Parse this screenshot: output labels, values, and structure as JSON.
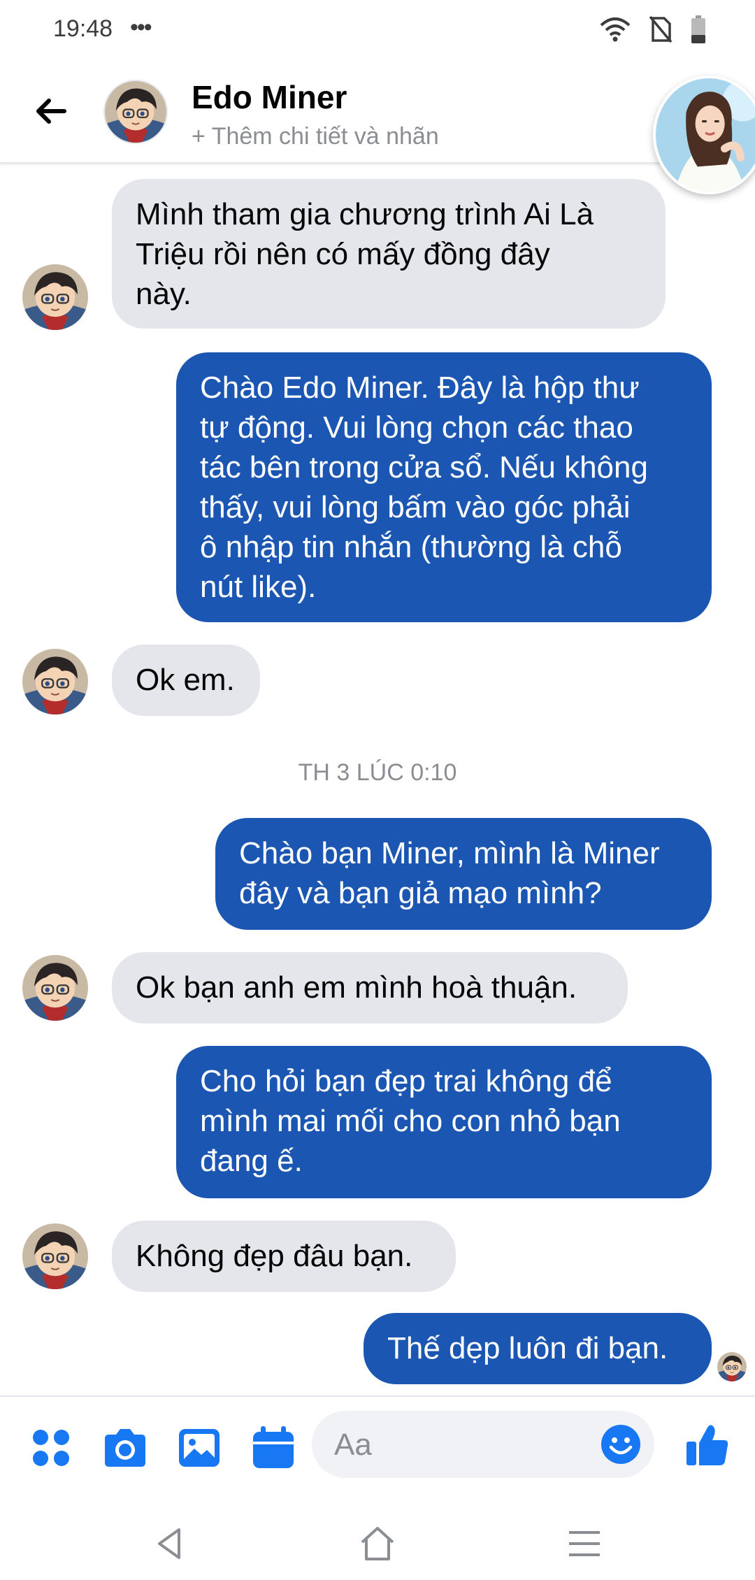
{
  "status": {
    "time": "19:48",
    "dots": "•••"
  },
  "header": {
    "contact_name": "Edo Miner",
    "subtitle": "+ Thêm chi tiết và nhãn"
  },
  "messages": [
    {
      "from": "them",
      "text_lines": [
        "Mình tham gia chương trình Ai Là",
        "Triệu rồi nên có mấy đồng đây",
        "này."
      ]
    },
    {
      "from": "me",
      "text_lines": [
        "Chào Edo Miner. Đây là hộp thư",
        "tự động. Vui lòng chọn các thao",
        "tác bên trong cửa sổ. Nếu không",
        "thấy, vui lòng bấm vào góc phải",
        "ô nhập tin nhắn (thường là chỗ",
        "nút like)."
      ]
    },
    {
      "from": "them",
      "text_lines": [
        "Ok em."
      ]
    },
    {
      "from": "me",
      "text_lines": [
        "Chào bạn Miner, mình là Miner",
        "đây và bạn giả mạo mình?"
      ]
    },
    {
      "from": "them",
      "text_lines": [
        "Ok bạn anh em mình hoà thuận."
      ]
    },
    {
      "from": "me",
      "text_lines": [
        "Cho hỏi bạn đẹp trai không để",
        "mình mai mối cho con nhỏ bạn",
        "đang ế."
      ]
    },
    {
      "from": "them",
      "text_lines": [
        "Không đẹp đâu bạn."
      ]
    },
    {
      "from": "me",
      "text_lines": [
        "Thế dẹp luôn đi bạn."
      ]
    }
  ],
  "timestamp": "TH 3 LÚC 0:10",
  "composer": {
    "placeholder": "Aa",
    "icons": [
      "apps-icon",
      "camera-icon",
      "gallery-icon",
      "calendar-icon",
      "emoji-icon",
      "like-icon"
    ]
  },
  "colors": {
    "outgoing_bubble": "#1b56b2",
    "incoming_bubble": "#e4e6eb",
    "accent": "#1877f2"
  }
}
